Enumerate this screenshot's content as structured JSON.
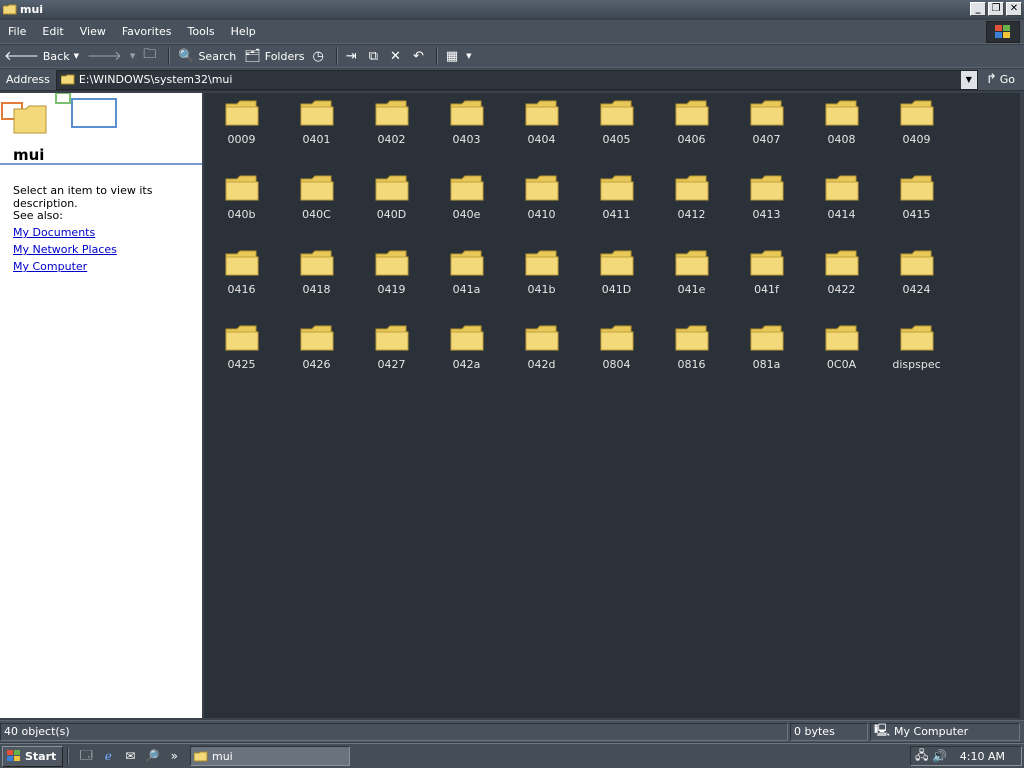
{
  "window": {
    "title": "mui"
  },
  "menu": [
    "File",
    "Edit",
    "View",
    "Favorites",
    "Tools",
    "Help"
  ],
  "toolbar": {
    "back": "Back",
    "search": "Search",
    "folders": "Folders"
  },
  "address": {
    "label": "Address",
    "path": "E:\\WINDOWS\\system32\\mui",
    "go": "Go"
  },
  "taskpane": {
    "title": "mui",
    "description": "Select an item to view its description.",
    "see_also": "See also:",
    "links": [
      "My Documents",
      "My Network Places",
      "My Computer"
    ]
  },
  "folders": [
    "0009",
    "0401",
    "0402",
    "0403",
    "0404",
    "0405",
    "0406",
    "0407",
    "0408",
    "0409",
    "040b",
    "040C",
    "040D",
    "040e",
    "0410",
    "0411",
    "0412",
    "0413",
    "0414",
    "0415",
    "0416",
    "0418",
    "0419",
    "041a",
    "041b",
    "041D",
    "041e",
    "041f",
    "0422",
    "0424",
    "0425",
    "0426",
    "0427",
    "042a",
    "042d",
    "0804",
    "0816",
    "081a",
    "0C0A",
    "dispspec"
  ],
  "status": {
    "objects": "40 object(s)",
    "size": "0 bytes",
    "location": "My Computer"
  },
  "taskbar": {
    "start": "Start",
    "task": "mui",
    "clock": "4:10 AM"
  },
  "colors": {
    "folder": "#f4d97a",
    "link": "#0000cc",
    "desktop": "#2b3138"
  }
}
